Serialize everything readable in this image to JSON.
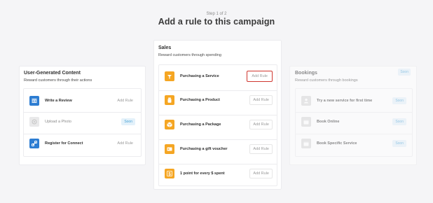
{
  "header": {
    "step": "Step 1 of 2",
    "title": "Add a rule to this campaign"
  },
  "columns": {
    "ugc": {
      "title": "User-Generated Content",
      "subtitle": "Reward customers through their actions",
      "rules": [
        {
          "label": "Write a Review",
          "action": "Add Rule",
          "icon": "review-icon"
        },
        {
          "label": "Upload a Photo",
          "action": "Soon",
          "icon": "photo-icon"
        },
        {
          "label": "Register for Connect",
          "action": "Add Rule",
          "icon": "link-icon"
        }
      ]
    },
    "sales": {
      "title": "Sales",
      "subtitle": "Reward customers through spending",
      "rules": [
        {
          "label": "Purchasing a Service",
          "action": "Add Rule",
          "icon": "service-icon"
        },
        {
          "label": "Purchasing a Product",
          "action": "Add Rule",
          "icon": "product-icon"
        },
        {
          "label": "Purchasing a Package",
          "action": "Add Rule",
          "icon": "package-icon"
        },
        {
          "label": "Purchasing a gift voucher",
          "action": "Add Rule",
          "icon": "voucher-icon"
        },
        {
          "label": "1 point for every $ spent",
          "action": "Add Rule",
          "icon": "dollar-icon"
        }
      ]
    },
    "bookings": {
      "title": "Bookings",
      "subtitle": "Reward customers through bookings",
      "badge": "Soon",
      "rules": [
        {
          "label": "Try a new service for first time",
          "action": "Soon",
          "icon": "user-icon"
        },
        {
          "label": "Book Online",
          "action": "Soon",
          "icon": "calendar-icon"
        },
        {
          "label": "Book Specific Service",
          "action": "Soon",
          "icon": "calendar-icon"
        }
      ]
    }
  },
  "colors": {
    "accent_blue": "#2d7dd2",
    "accent_orange": "#f5a623",
    "highlight_red": "#d0362f",
    "soon_blue": "#4aa3d6"
  }
}
